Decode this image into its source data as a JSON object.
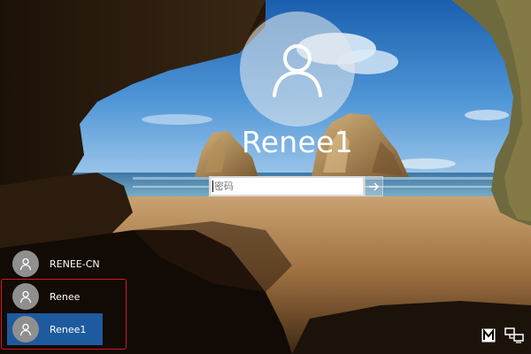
{
  "lock_screen": {
    "current_user": "Renee1",
    "password": {
      "placeholder": "密码",
      "value": ""
    },
    "submit_icon": "arrow-right-icon"
  },
  "users": [
    {
      "label": "RENEE-CN",
      "selected": false,
      "icon": "user-icon"
    },
    {
      "label": "Renee",
      "selected": false,
      "icon": "user-icon"
    },
    {
      "label": "Renee1",
      "selected": true,
      "icon": "user-icon"
    }
  ],
  "highlighted_users": [
    "Renee",
    "Renee1"
  ],
  "corner": {
    "ease_of_access_icon": "ease-of-access-icon",
    "network_icon": "network-icon"
  },
  "colors": {
    "selection": "#1e5a9e",
    "highlight_frame": "#d0191f",
    "avatar_fill": "#8f8f8f"
  }
}
